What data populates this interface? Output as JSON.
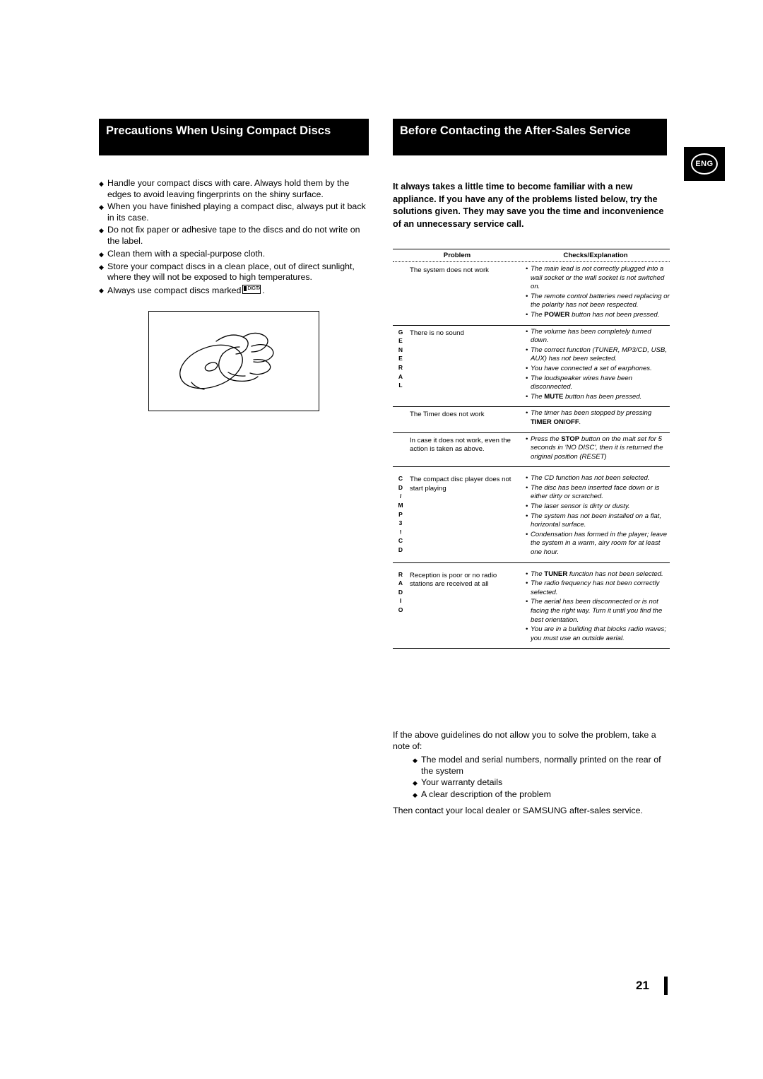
{
  "headers": {
    "left": "Precautions When Using Compact Discs",
    "right": "Before Contacting the After-Sales Service"
  },
  "badge": {
    "label": "ENG"
  },
  "precautions": [
    "Handle your compact discs with care. Always hold them by the edges to avoid leaving fingerprints on the shiny surface.",
    "When you have finished playing a compact disc, always put it back in its case.",
    "Do not fix paper or adhesive tape to the discs and do not write on the label.",
    "Clean them with a special-purpose cloth.",
    "Store your compact discs in a clean place, out of direct sunlight, where they will not be exposed to high temperatures.",
    "Always use compact discs marked"
  ],
  "disc_mark_text": "DIGITAL AUDIO",
  "intro": "It always takes a little time to become familiar with a new appliance. If you have any of the problems listed below, try the solutions given. They may save you the time and inconvenience of an unnecessary service call.",
  "table": {
    "headers": {
      "problem": "Problem",
      "checks": "Checks/Explanation"
    },
    "rows": [
      {
        "side": "",
        "problem": "The system does not work",
        "checks": [
          "The main lead is not correctly plugged into a wall socket or the wall socket is not switched on.",
          "The remote control batteries need replacing or the polarity has not been respected.",
          "The POWER button has not been pressed."
        ]
      },
      {
        "side": "GENERAL",
        "problem": "There is no sound",
        "checks": [
          "The volume has been completely turned down.",
          "The correct function (TUNER, MP3/CD, USB, AUX) has not been selected.",
          "You have connected a set of earphones.",
          "The loudspeaker wires have been disconnected.",
          "The MUTE button has been pressed."
        ]
      },
      {
        "side": "",
        "problem": "The Timer does not work",
        "checks": [
          "The timer has been stopped by pressing TIMER ON/OFF."
        ]
      },
      {
        "side": "",
        "problem": "In case it does not work, even the action is taken as above.",
        "checks": [
          "Press the STOP button on the mait set for 5 seconds in 'NO DISC', then it is returned the original position (RESET)"
        ]
      },
      {
        "side": "CD/MP3CD",
        "problem": "The compact disc player does not start playing",
        "checks": [
          "The CD function has not been selected.",
          "The disc has been inserted face down or is either dirty or scratched.",
          "The laser sensor is dirty or dusty.",
          "The system has not been installed on a flat, horizontal surface.",
          "Condensation has formed in the player; leave the system in a warm, airy room for at least one hour."
        ]
      },
      {
        "side": "RADIO",
        "problem": "Reception is poor or no radio stations are received at all",
        "checks": [
          "The TUNER function has not been selected.",
          "The radio frequency has not been correctly selected.",
          "The aerial has been disconnected or is not facing the right way. Turn it until you find the best orientation.",
          "You are in a building that blocks radio waves; you must use an outside aerial."
        ]
      }
    ]
  },
  "footer": {
    "lead": "If the above guidelines do not allow you to solve the problem, take a note of:",
    "items": [
      "The model and serial numbers, normally printed on the rear of  the system",
      "Your warranty details",
      "A clear description of the problem"
    ],
    "last": "Then contact your local dealer or SAMSUNG after-sales service."
  },
  "page_number": "21"
}
